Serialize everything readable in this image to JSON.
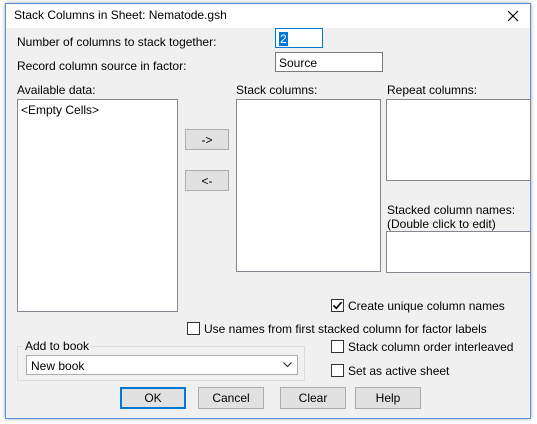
{
  "window": {
    "title": "Stack Columns in Sheet: Nematode.gsh"
  },
  "fields": {
    "num_columns_label": "Number of columns to stack together:",
    "num_columns_value": "2",
    "record_source_label": "Record column source in factor:",
    "record_source_value": "Source"
  },
  "lists": {
    "available_label": "Available data:",
    "available_items": [
      "<Empty Cells>"
    ],
    "stack_label": "Stack columns:",
    "repeat_label": "Repeat columns:",
    "stacked_names_label_1": "Stacked column names:",
    "stacked_names_label_2": "(Double click to edit)"
  },
  "transfer": {
    "add_label": "->",
    "remove_label": "<-"
  },
  "options": {
    "unique_names_label": "Create unique column names",
    "unique_names_checked": true,
    "use_names_label": "Use names from first stacked column for factor labels",
    "use_names_checked": false,
    "interleaved_label": "Stack column order interleaved",
    "interleaved_checked": false,
    "active_sheet_label": "Set as active sheet",
    "active_sheet_checked": false
  },
  "book": {
    "group_label": "Add to book",
    "selected": "New book"
  },
  "buttons": {
    "ok": "OK",
    "cancel": "Cancel",
    "clear": "Clear",
    "help": "Help"
  }
}
